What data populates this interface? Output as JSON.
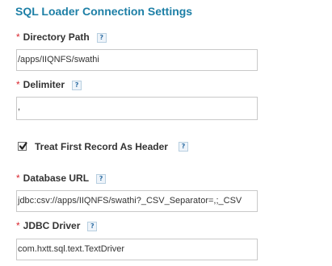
{
  "section": {
    "title": "SQL Loader Connection Settings"
  },
  "fields": {
    "directory_path": {
      "label": "Directory Path",
      "value": "/apps/IIQNFS/swathi",
      "help": "?"
    },
    "delimiter": {
      "label": "Delimiter",
      "value": ",",
      "help": "?"
    },
    "treat_first_record": {
      "label": "Treat First Record As Header",
      "checked": true,
      "help": "?"
    },
    "database_url": {
      "label": "Database URL",
      "value": "jdbc:csv://apps/IIQNFS/swathi?_CSV_Separator=,;_CSV",
      "help": "?"
    },
    "jdbc_driver": {
      "label": "JDBC Driver",
      "value": "com.hxtt.sql.text.TextDriver",
      "help": "?"
    }
  },
  "required_marker": "*",
  "colors": {
    "title": "#1d7fa6",
    "required": "#d9262e",
    "field_border": "#c9c9c9",
    "help_icon": "#2f6ea3"
  }
}
